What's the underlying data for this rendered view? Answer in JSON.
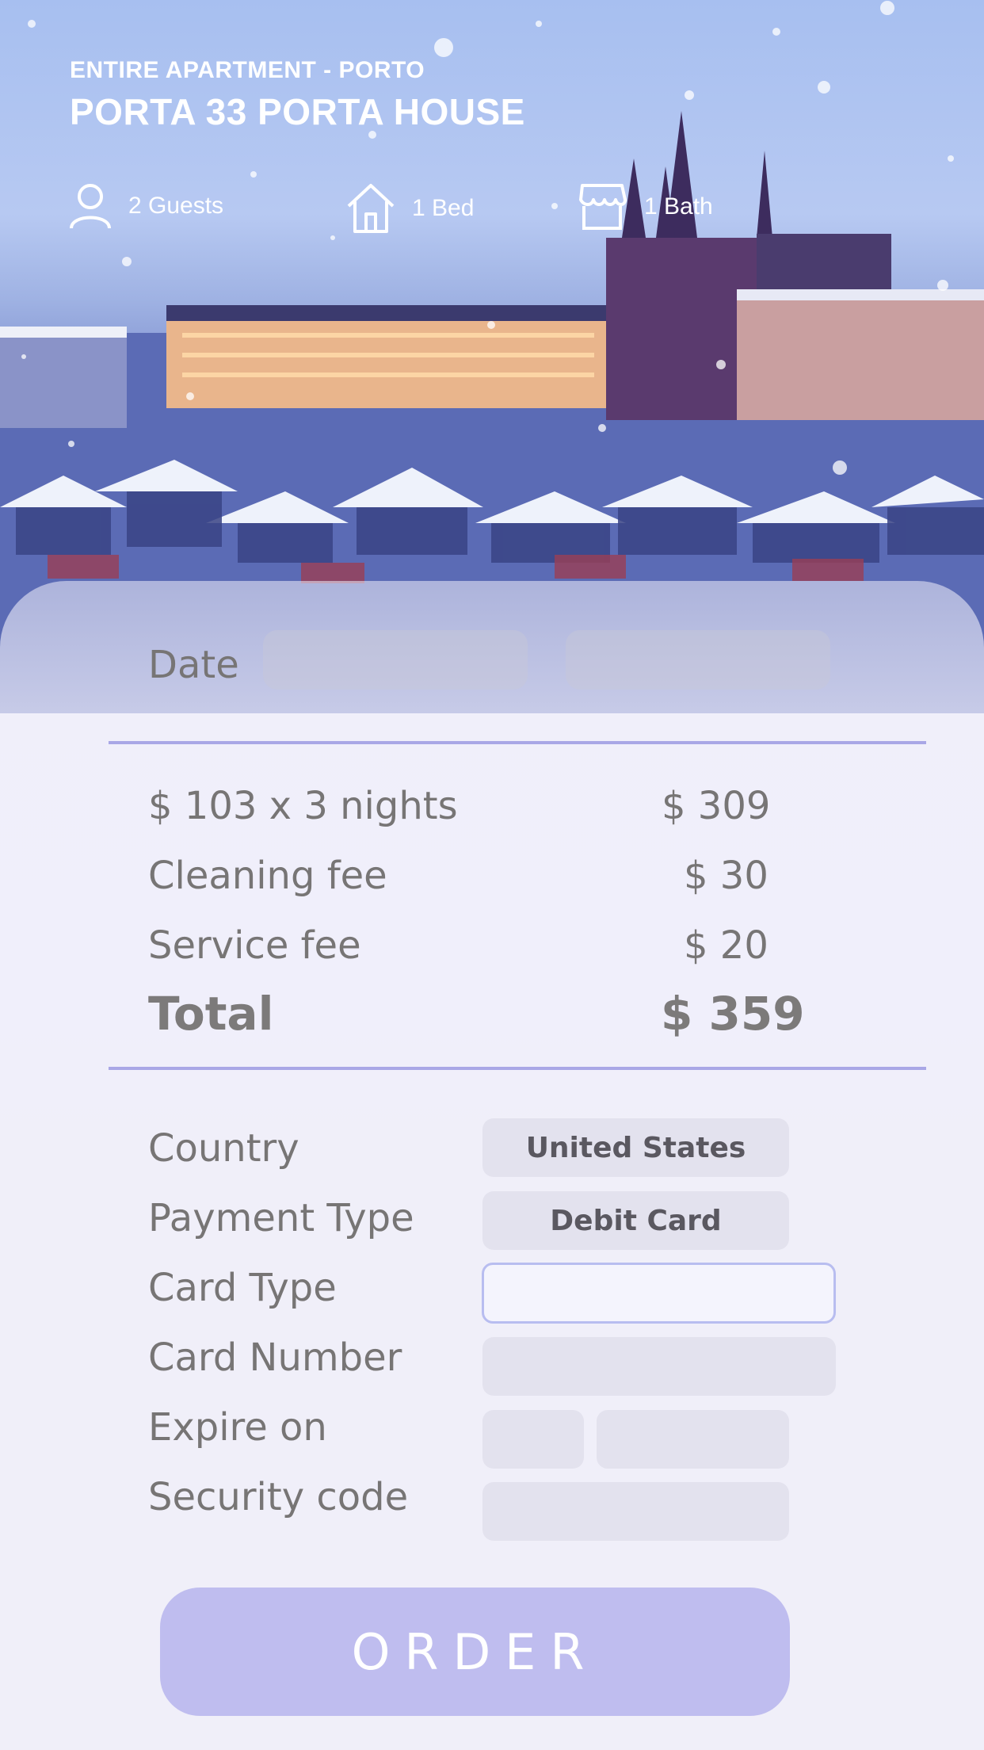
{
  "header": {
    "subtitle": "ENTIRE APARTMENT - PORTO",
    "title": "PORTA 33 PORTA HOUSE"
  },
  "amenities": [
    {
      "icon": "person-icon",
      "label": "2 Guests"
    },
    {
      "icon": "house-icon",
      "label": "1 Bed"
    },
    {
      "icon": "store-icon",
      "label": "1 Bath"
    }
  ],
  "booking": {
    "date_label": "Date",
    "date_start": "",
    "date_end": ""
  },
  "pricing": {
    "nightly_label": "$ 103  x 3 nights",
    "nightly_amount": "$ 309",
    "cleaning_label": "Cleaning fee",
    "cleaning_amount": "$ 30",
    "service_label": "Service fee",
    "service_amount": "$ 20",
    "total_label": "Total",
    "total_amount": "$ 359"
  },
  "payment": {
    "country_label": "Country",
    "country_value": "United States",
    "payment_type_label": "Payment Type",
    "payment_type_value": "Debit Card",
    "card_type_label": "Card Type",
    "card_type_value": "",
    "card_number_label": "Card Number",
    "card_number_value": "",
    "expire_label": "Expire on",
    "expire_month": "",
    "expire_year": "",
    "security_label": "Security code",
    "security_value": ""
  },
  "actions": {
    "order_label": "ORDER"
  },
  "colors": {
    "accent": "#bfbdef",
    "divider": "#a9a7e6",
    "field_bg": "#e3e2ee",
    "active_field_border": "#b8bdf0"
  }
}
